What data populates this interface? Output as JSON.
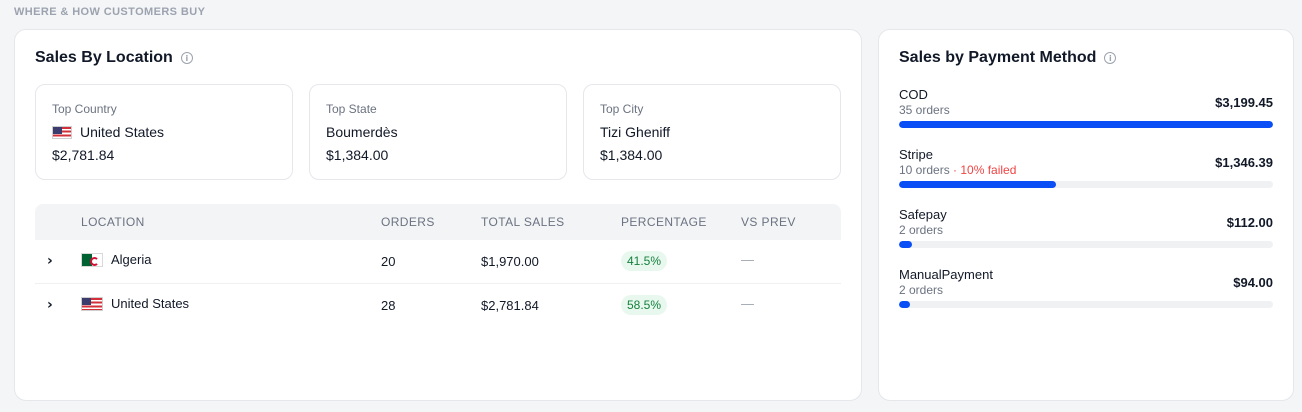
{
  "section_title": "WHERE & HOW CUSTOMERS BUY",
  "location": {
    "title": "Sales By Location",
    "top_country": {
      "label": "Top Country",
      "value": "United States",
      "amount": "$2,781.84",
      "flag": "us-flag"
    },
    "top_state": {
      "label": "Top State",
      "value": "Boumerdès",
      "amount": "$1,384.00"
    },
    "top_city": {
      "label": "Top City",
      "value": "Tizi Gheniff",
      "amount": "$1,384.00"
    },
    "table": {
      "columns": [
        "LOCATION",
        "ORDERS",
        "TOTAL SALES",
        "PERCENTAGE",
        "VS PREV"
      ],
      "rows": [
        {
          "location": "Algeria",
          "flag": "dz-flag",
          "orders": "20",
          "total_sales": "$1,970.00",
          "percentage": "41.5%",
          "vs_prev": "—"
        },
        {
          "location": "United States",
          "flag": "us-flag",
          "orders": "28",
          "total_sales": "$2,781.84",
          "percentage": "58.5%",
          "vs_prev": "—"
        }
      ]
    }
  },
  "payment": {
    "title": "Sales by Payment Method",
    "accent_color": "#0a4ff5",
    "methods": [
      {
        "name": "COD",
        "orders": "35 orders",
        "failed": "",
        "amount": "$3,199.45",
        "share": 1.0
      },
      {
        "name": "Stripe",
        "orders": "10 orders",
        "failed": " · 10% failed",
        "amount": "$1,346.39",
        "share": 0.42
      },
      {
        "name": "Safepay",
        "orders": "2 orders",
        "failed": "",
        "amount": "$112.00",
        "share": 0.035
      },
      {
        "name": "ManualPayment",
        "orders": "2 orders",
        "failed": "",
        "amount": "$94.00",
        "share": 0.029
      }
    ]
  }
}
